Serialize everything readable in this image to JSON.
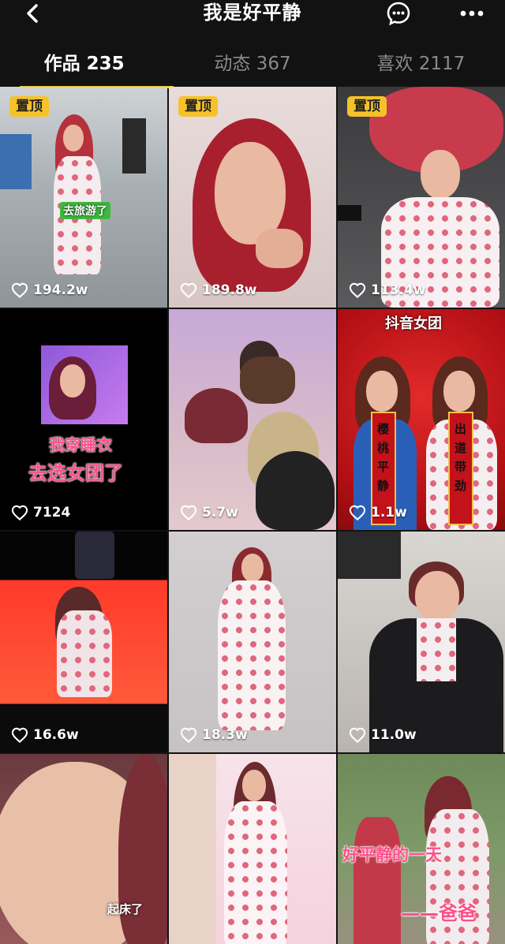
{
  "header": {
    "title": "我是好平静",
    "back_icon": "chevron-left-icon",
    "message_icon": "message-icon",
    "more_icon": "more-icon"
  },
  "tabs": [
    {
      "label": "作品 235",
      "active": true
    },
    {
      "label": "动态 367",
      "active": false
    },
    {
      "label": "喜欢 2117",
      "active": false
    }
  ],
  "accent_color": "#f6c22a",
  "videos": [
    {
      "pinned_label": "置顶",
      "likes": "194.2w",
      "caption": "去旅游了"
    },
    {
      "pinned_label": "置顶",
      "likes": "189.8w"
    },
    {
      "pinned_label": "置顶",
      "likes": "113.4w"
    },
    {
      "likes": "7124",
      "caption_line1": "我穿睡衣",
      "caption_line2": "去选女团了"
    },
    {
      "likes": "5.7w"
    },
    {
      "likes": "1.1w",
      "banner": "抖音女团",
      "couplet_left": "樱桃平静",
      "couplet_right": "出道带劲"
    },
    {
      "likes": "16.6w"
    },
    {
      "likes": "18.3w"
    },
    {
      "likes": "11.0w"
    },
    {
      "caption": "起床了"
    },
    {},
    {
      "caption_line1": "好平静的一天",
      "caption_line2": "——爸爸"
    }
  ]
}
